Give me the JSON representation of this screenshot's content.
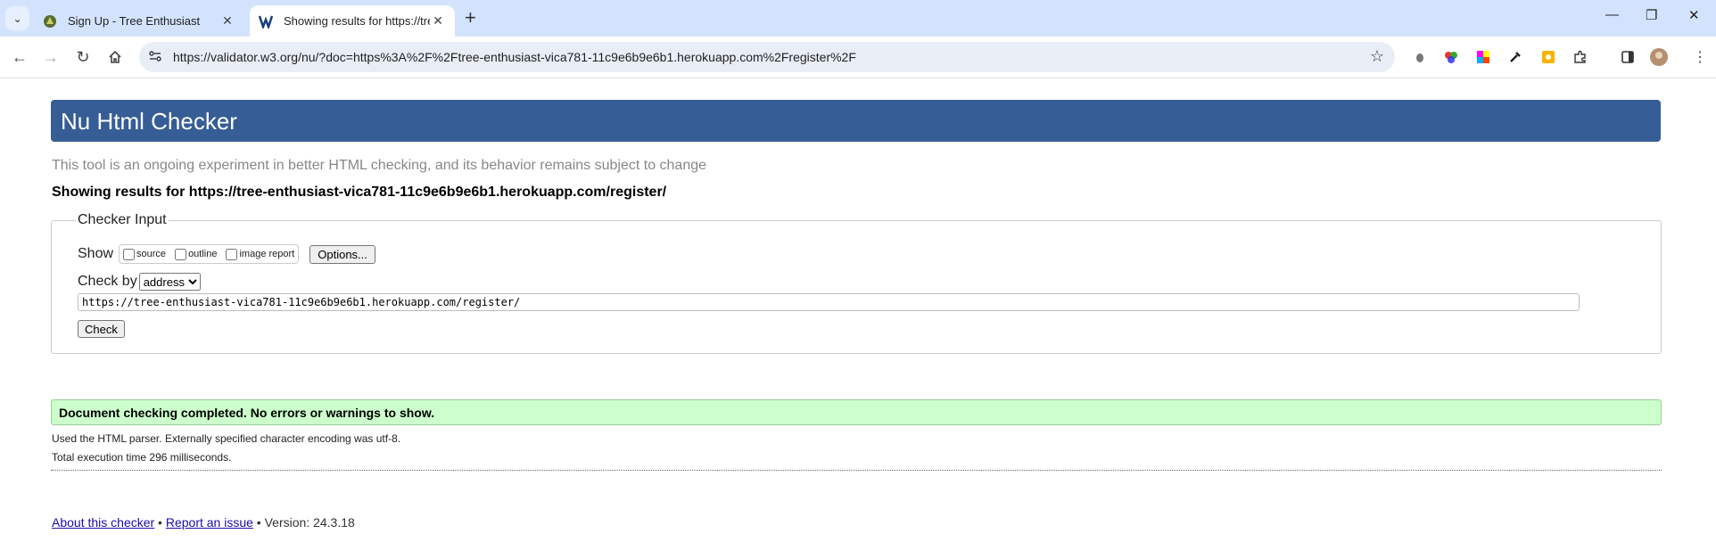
{
  "browser": {
    "tabs": [
      {
        "title": "Sign Up - Tree Enthusiast",
        "active": false
      },
      {
        "title": "Showing results for https://tree",
        "active": true
      }
    ],
    "address": "https://validator.w3.org/nu/?doc=https%3A%2F%2Ftree-enthusiast-vica781-11c9e6b9e6b1.herokuapp.com%2Fregister%2F"
  },
  "page": {
    "title": "Nu Html Checker",
    "tagline": "This tool is an ongoing experiment in better HTML checking, and its behavior remains subject to change",
    "showing": "Showing results for https://tree-enthusiast-vica781-11c9e6b9e6b1.herokuapp.com/register/",
    "checker": {
      "legend": "Checker Input",
      "show_label": "Show",
      "opt_source": "source",
      "opt_outline": "outline",
      "opt_image": "image report",
      "options_button": "Options...",
      "checkby_label": "Check by",
      "checkby_value": "address",
      "url_value": "https://tree-enthusiast-vica781-11c9e6b9e6b1.herokuapp.com/register/",
      "check_button": "Check"
    },
    "result": "Document checking completed. No errors or warnings to show.",
    "info_parser": "Used the HTML parser. Externally specified character encoding was utf-8.",
    "info_time": "Total execution time 296 milliseconds.",
    "footer": {
      "about": "About this checker",
      "sep1": " • ",
      "report": "Report an issue",
      "version": " • Version: 24.3.18"
    }
  },
  "colors": {
    "header_bg": "#365d95",
    "success_bg": "#ccffcc",
    "tabstrip_bg": "#d3e3fd"
  }
}
